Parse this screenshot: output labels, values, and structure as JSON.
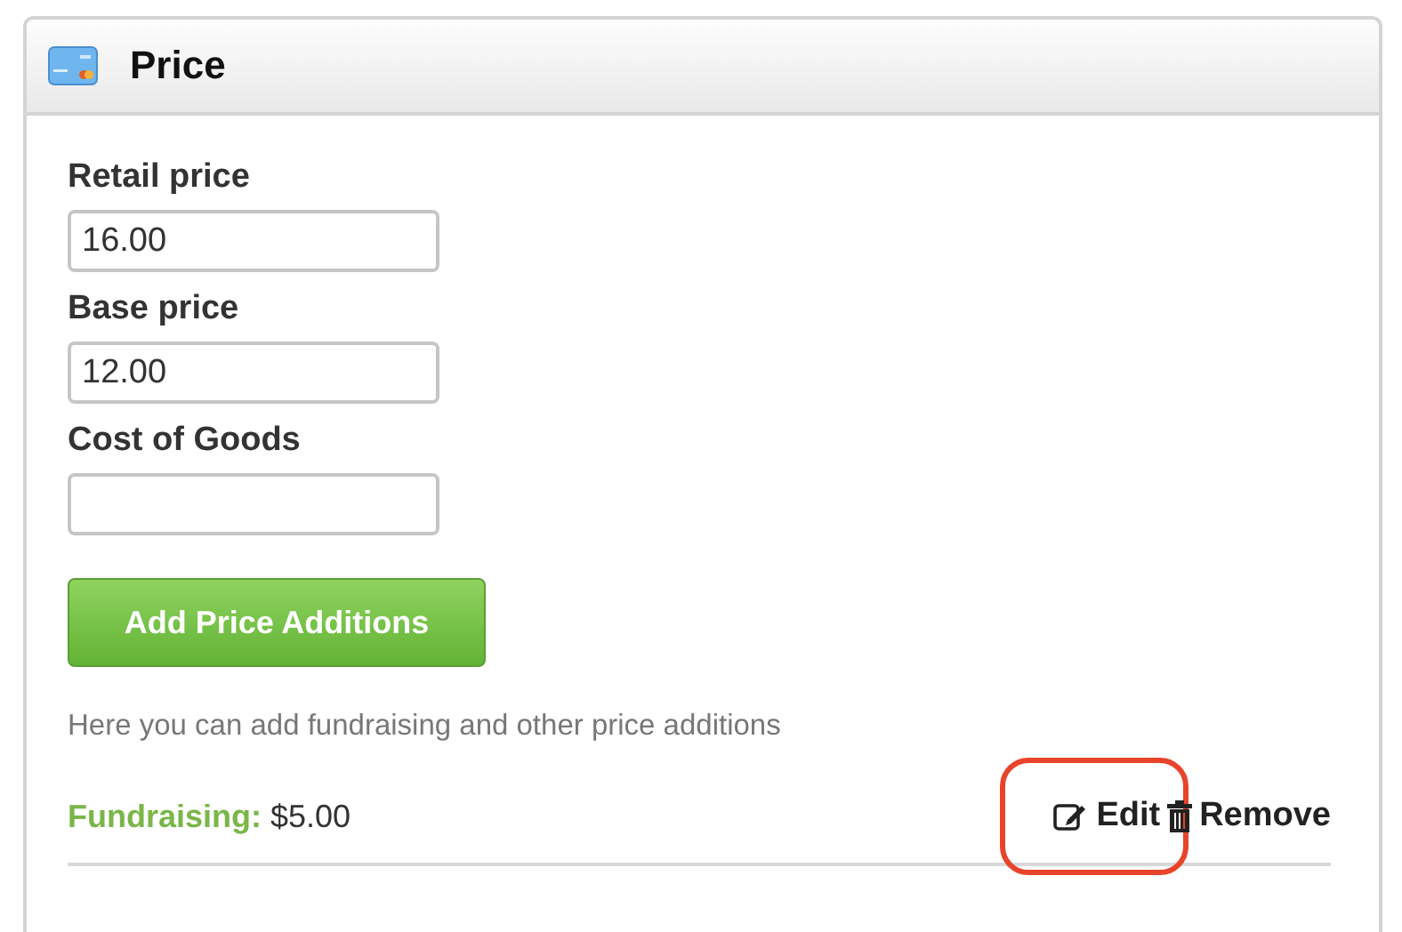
{
  "panel": {
    "title": "Price"
  },
  "fields": [
    {
      "label": "Retail price",
      "value": "16.00"
    },
    {
      "label": "Base price",
      "value": "12.00"
    },
    {
      "label": "Cost of Goods"
    }
  ],
  "add_button": "Add Price Additions",
  "hint": "Here you can add fundraising and other price additions",
  "additions": [
    {
      "name": "Fundraising:",
      "amount": "$5.00",
      "actions": [
        {
          "kind": "edit",
          "label": "Edit",
          "highlighted": true
        },
        {
          "kind": "remove",
          "label": "Remove",
          "highlighted": false
        }
      ]
    }
  ]
}
